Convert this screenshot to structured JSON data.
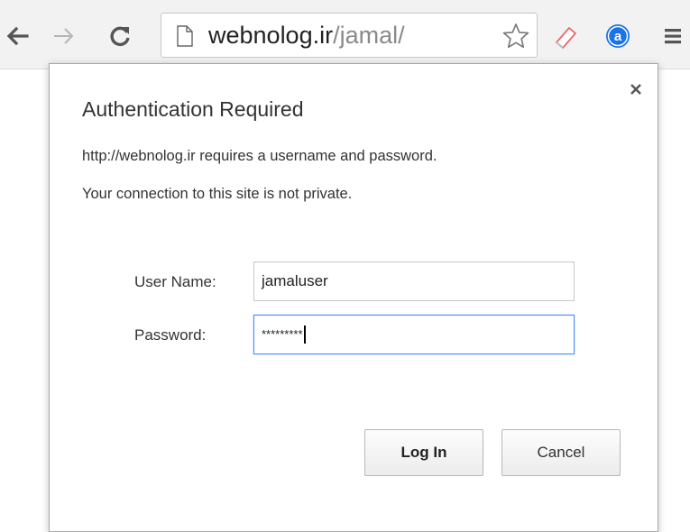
{
  "browser": {
    "nav": {
      "back_icon": "back-arrow-icon",
      "forward_icon": "forward-arrow-icon",
      "reload_icon": "reload-icon"
    },
    "omnibox": {
      "page_icon": "page-icon",
      "url_host": "webnolog.ir",
      "url_path": "/jamal/",
      "bookmark_icon": "star-icon"
    },
    "extensions": [
      {
        "name": "eraser-icon"
      },
      {
        "name": "a-circle-icon",
        "glyph": "a",
        "color": "#1a73e8"
      }
    ],
    "menu_icon": "hamburger-menu-icon"
  },
  "dialog": {
    "title": "Authentication Required",
    "message_1": "http://webnolog.ir requires a username and password.",
    "message_2": "Your connection to this site is not private.",
    "close_glyph": "×",
    "username": {
      "label": "User Name:",
      "value": "jamaluser"
    },
    "password": {
      "label": "Password:",
      "value": "*********"
    },
    "buttons": {
      "login_label": "Log In",
      "cancel_label": "Cancel"
    }
  },
  "colors": {
    "focus_border": "#4d90fe",
    "toolbar_bg": "#f2f2f2"
  }
}
